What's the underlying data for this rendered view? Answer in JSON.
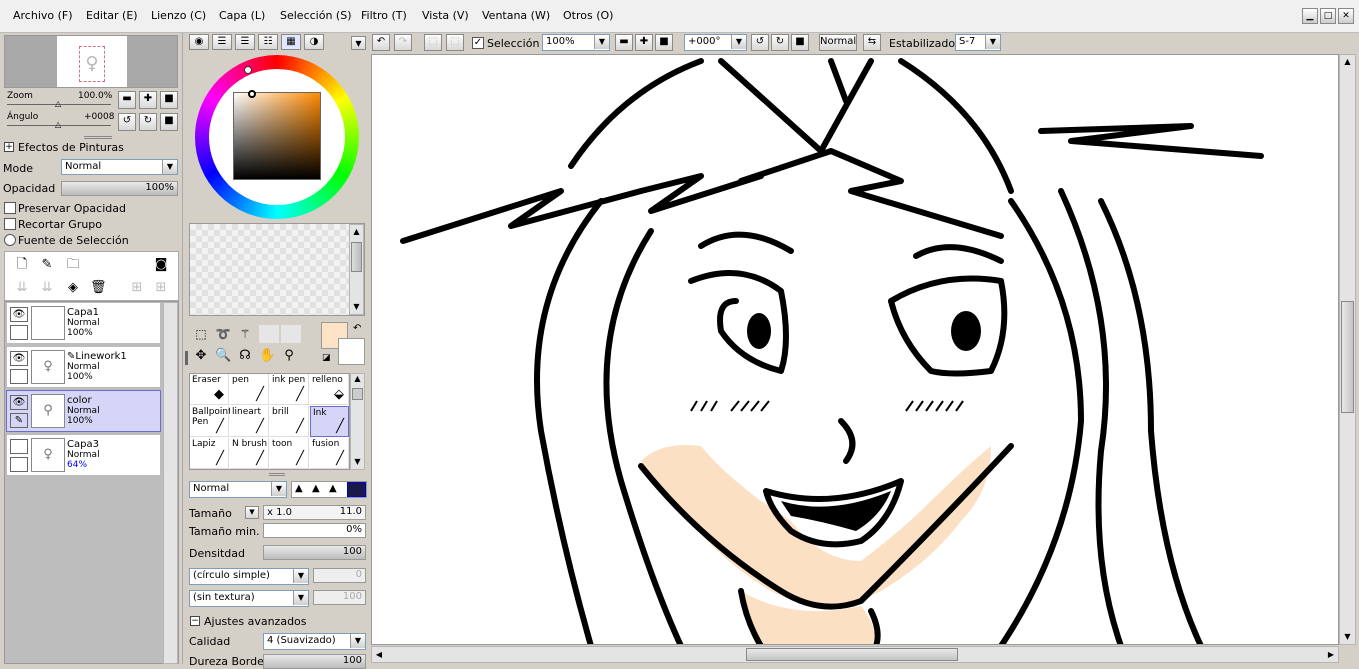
{
  "menu": [
    "Archivo (F)",
    "Editar (E)",
    "Lienzo (C)",
    "Capa (L)",
    "Selección (S)",
    "Filtro (T)",
    "Vista (V)",
    "Ventana (W)",
    "Otros (O)"
  ],
  "navigator": {
    "zoom_label": "Zoom",
    "zoom_value": "100.0%",
    "angle_label": "Ángulo",
    "angle_value": "+0008"
  },
  "layer_panel": {
    "effects_label": "Efectos de Pinturas",
    "mode_label": "Mode",
    "mode_value": "Normal",
    "opacity_label": "Opacidad",
    "opacity_value": "100%",
    "preserve_opacity": "Preservar Opacidad",
    "clip_group": "Recortar Grupo",
    "selection_source": "Fuente de Selección",
    "layers": [
      {
        "name": "Capa1",
        "mode": "Normal",
        "opacity": "100%",
        "selected": false
      },
      {
        "name": "Linework1",
        "mode": "Normal",
        "opacity": "100%",
        "selected": false
      },
      {
        "name": "color",
        "mode": "Normal",
        "opacity": "100%",
        "selected": true
      },
      {
        "name": "Capa3",
        "mode": "Normal",
        "opacity": "64%",
        "selected": false
      }
    ]
  },
  "colors": {
    "primary": "#fde3c6",
    "secondary": "#ffffff",
    "skin": "#fbe0c4",
    "selection_hl": "#d5d5f7"
  },
  "tools": [
    {
      "name": "Eraser",
      "glyph": "◆"
    },
    {
      "name": "pen",
      "glyph": "╱"
    },
    {
      "name": "ink pen",
      "glyph": "╱"
    },
    {
      "name": "relleno",
      "glyph": "⬙"
    },
    {
      "name": "Ballpoint Pen",
      "glyph": "╱"
    },
    {
      "name": "lineart",
      "glyph": "╱"
    },
    {
      "name": "brill",
      "glyph": "╱"
    },
    {
      "name": "Ink",
      "glyph": "╱"
    },
    {
      "name": "Lapiz",
      "glyph": "╱"
    },
    {
      "name": "N brush",
      "glyph": "╱"
    },
    {
      "name": "toon",
      "glyph": "╱"
    },
    {
      "name": "fusion",
      "glyph": "╱"
    }
  ],
  "brush": {
    "blend_mode": "Normal",
    "size_label": "Tamaño",
    "size_mult": "x 1.0",
    "size_value": "11.0",
    "min_size_label": "Tamaño min.",
    "min_size_value": "0%",
    "density_label": "Densitdad",
    "density_value": "100",
    "shape": "(círculo simple)",
    "shape_value": "0",
    "texture": "(sin textura)",
    "texture_value": "100",
    "advanced_label": "Ajustes avanzados",
    "quality_label": "Calidad",
    "quality_value": "4 (Suavizado)",
    "hardness_label": "Dureza Borde",
    "hardness_value": "100"
  },
  "toolbar": {
    "selection_label": "Selección",
    "zoom_value": "100%",
    "rotation_value": "+000°",
    "mode_value": "Normal",
    "stabilizer_label": "Estabilizador",
    "stabilizer_value": "S-7"
  }
}
